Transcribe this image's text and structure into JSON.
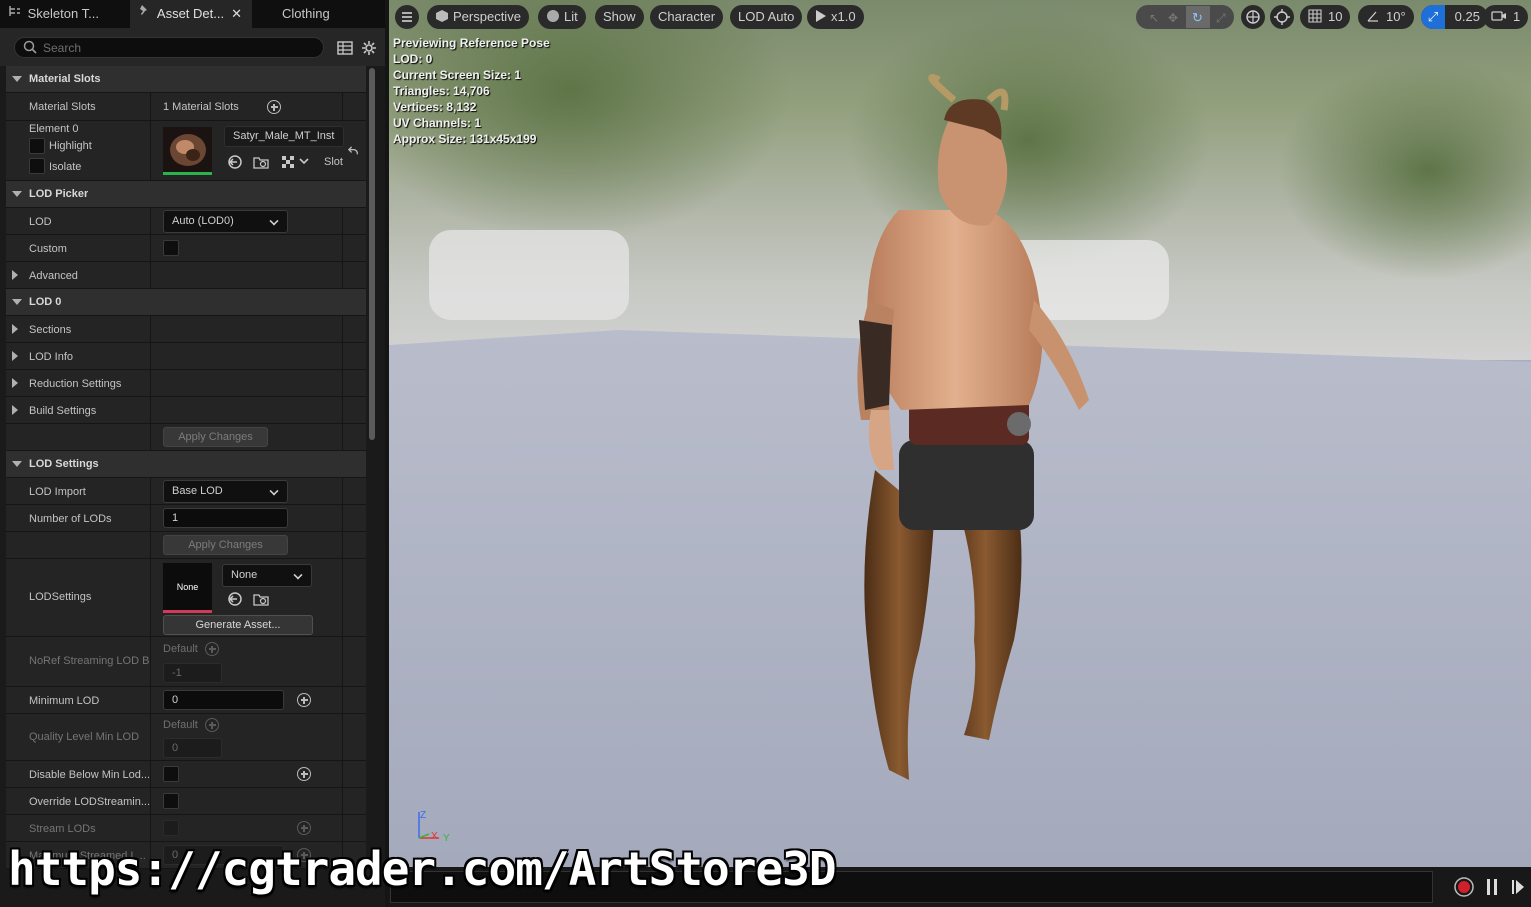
{
  "tabs": [
    {
      "label": "Skeleton T...",
      "icon": "skeleton-icon"
    },
    {
      "label": "Asset Det...",
      "icon": "pin-icon",
      "active": true
    },
    {
      "label": "Clothing"
    }
  ],
  "search": {
    "placeholder": "Search"
  },
  "material_slots": {
    "header": "Material Slots",
    "label": "Material Slots",
    "count": "1 Material Slots",
    "element_label": "Element 0",
    "highlight": "Highlight",
    "isolate": "Isolate",
    "material_name": "Satyr_Male_MT_Inst",
    "slot": "Slot"
  },
  "lod_picker": {
    "header": "LOD Picker",
    "lod_label": "LOD",
    "lod_value": "Auto (LOD0)",
    "custom_label": "Custom",
    "advanced_label": "Advanced"
  },
  "lod0": {
    "header": "LOD 0",
    "sections": "Sections",
    "lod_info": "LOD Info",
    "reduction": "Reduction Settings",
    "build": "Build Settings",
    "apply": "Apply Changes"
  },
  "lod_settings": {
    "header": "LOD Settings",
    "import_label": "LOD Import",
    "import_value": "Base LOD",
    "num_lods_label": "Number of LODs",
    "num_lods_value": "1",
    "apply": "Apply Changes",
    "lodsettings_label": "LODSettings",
    "lodsettings_thumb": "None",
    "lodsettings_value": "None",
    "generate": "Generate Asset...",
    "noref_label": "NoRef Streaming LOD B",
    "noref_default": "Default",
    "noref_value": "-1",
    "min_lod_label": "Minimum LOD",
    "min_lod_value": "0",
    "quality_label": "Quality Level Min LOD",
    "quality_default": "Default",
    "quality_value": "0",
    "disable_below_label": "Disable Below Min Lod...",
    "override_label": "Override LODStreamin...",
    "stream_lods_label": "Stream LODs",
    "max_streamed_label": "Maximum Streamed L...",
    "max_streamed_value": "0"
  },
  "viewport": {
    "toolbar": {
      "perspective": "Perspective",
      "lit": "Lit",
      "show": "Show",
      "character": "Character",
      "lod_auto": "LOD Auto",
      "play_speed": "x1.0",
      "grid_snap": "10",
      "rot_snap": "10°",
      "scale_snap": "0.25",
      "camera_speed": "1"
    },
    "stats": [
      "Previewing Reference Pose",
      "LOD: 0",
      "Current Screen Size: 1",
      "Triangles: 14,706",
      "Vertices: 8,132",
      "UV Channels: 1",
      "Approx Size: 131x45x199"
    ],
    "axis": {
      "z": "Z",
      "x": "X",
      "y": "Y"
    }
  },
  "watermark": "https://cgtrader.com/ArtStore3D",
  "colors": {
    "accent": "#1f6fd8",
    "record": "#d0202c",
    "material_ok": "#2bb24a",
    "lod_none": "#d23a5a"
  }
}
